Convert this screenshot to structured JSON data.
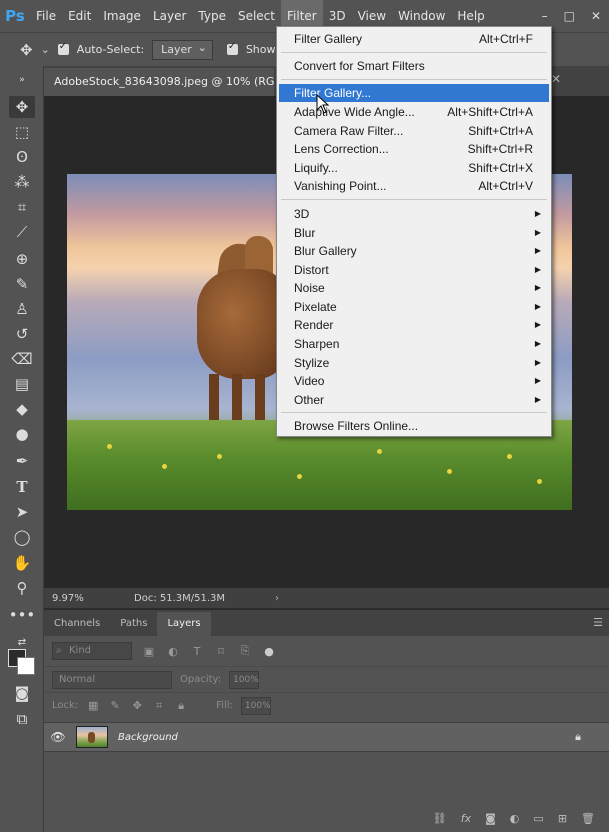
{
  "app": {
    "logo": "Ps"
  },
  "menubar": {
    "items": [
      "File",
      "Edit",
      "Image",
      "Layer",
      "Type",
      "Select",
      "Filter",
      "3D",
      "View",
      "Window",
      "Help"
    ],
    "active": "Filter",
    "controls": {
      "minimize": "–",
      "maximize": "□",
      "close": "✕"
    }
  },
  "options_bar": {
    "auto_select_label": "Auto-Select:",
    "auto_select_value": "Layer",
    "show_transform_label": "Show Tr"
  },
  "document": {
    "tab_title": "AdobeStock_83643098.jpeg @ 10% (RGB/8)",
    "close": "✕"
  },
  "status": {
    "zoom": "9.97%",
    "doc_size": "Doc: 51.3M/51.3M",
    "arrow": "›"
  },
  "filter_menu": {
    "last_filter": {
      "label": "Filter Gallery",
      "shortcut": "Alt+Ctrl+F"
    },
    "convert": {
      "label": "Convert for Smart Filters"
    },
    "group1": [
      {
        "label": "Filter Gallery...",
        "shortcut": ""
      },
      {
        "label": "Adaptive Wide Angle...",
        "shortcut": "Alt+Shift+Ctrl+A"
      },
      {
        "label": "Camera Raw Filter...",
        "shortcut": "Shift+Ctrl+A"
      },
      {
        "label": "Lens Correction...",
        "shortcut": "Shift+Ctrl+R"
      },
      {
        "label": "Liquify...",
        "shortcut": "Shift+Ctrl+X"
      },
      {
        "label": "Vanishing Point...",
        "shortcut": "Alt+Ctrl+V"
      }
    ],
    "submenus": [
      "3D",
      "Blur",
      "Blur Gallery",
      "Distort",
      "Noise",
      "Pixelate",
      "Render",
      "Sharpen",
      "Stylize",
      "Video",
      "Other"
    ],
    "browse": {
      "label": "Browse Filters Online..."
    }
  },
  "layers_panel": {
    "tabs": [
      "Channels",
      "Paths",
      "Layers"
    ],
    "active_tab": "Layers",
    "kind_placeholder": "Kind",
    "blend_mode": "Normal",
    "opacity_label": "Opacity:",
    "opacity_value": "100%",
    "lock_label": "Lock:",
    "fill_label": "Fill:",
    "fill_value": "100%",
    "layers": [
      {
        "name": "Background",
        "visible": true,
        "locked": true
      }
    ]
  },
  "colors": {
    "accent_highlight": "#3078d2",
    "ps_logo": "#3fa8f5"
  }
}
